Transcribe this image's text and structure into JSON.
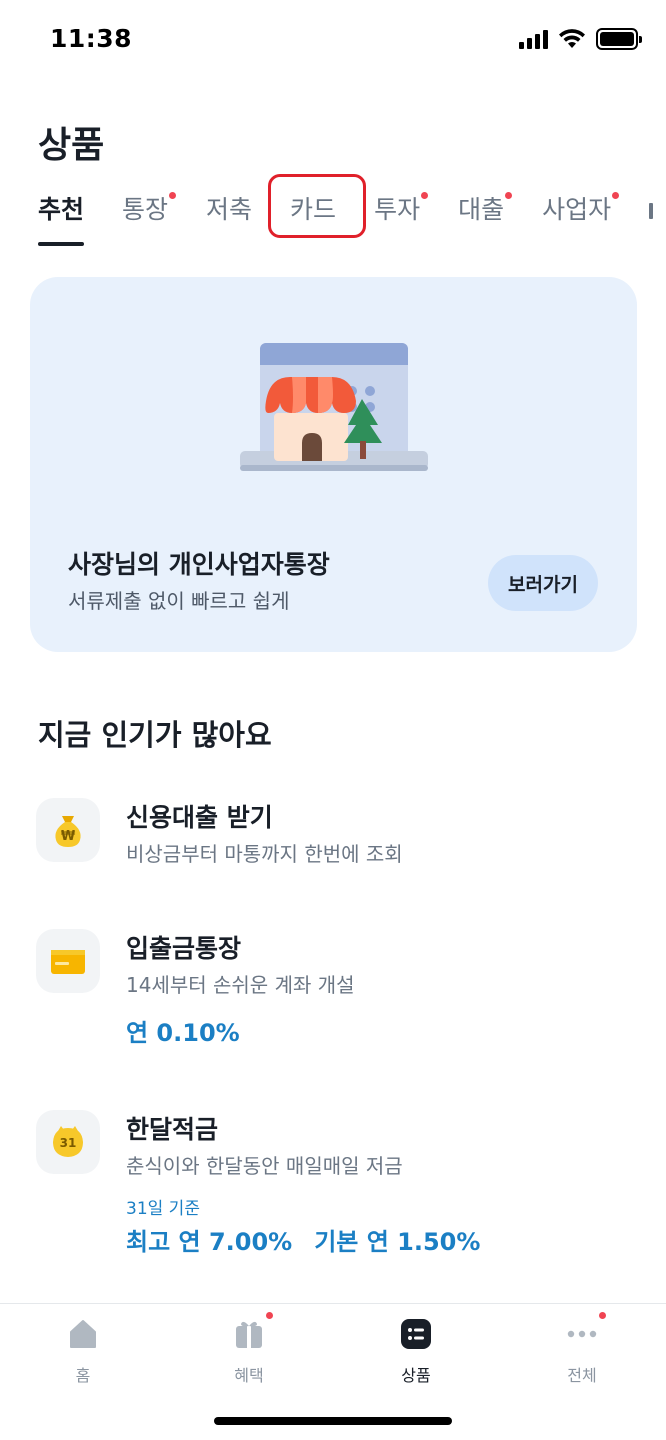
{
  "status_bar": {
    "time": "11:38"
  },
  "page": {
    "title": "상품"
  },
  "tabs": [
    {
      "label": "추천",
      "active": true,
      "dot": false
    },
    {
      "label": "통장",
      "active": false,
      "dot": true
    },
    {
      "label": "저축",
      "active": false,
      "dot": false
    },
    {
      "label": "카드",
      "active": false,
      "dot": false
    },
    {
      "label": "투자",
      "active": false,
      "dot": true
    },
    {
      "label": "대출",
      "active": false,
      "dot": true
    },
    {
      "label": "사업자",
      "active": false,
      "dot": true
    }
  ],
  "banner": {
    "title": "사장님의 개인사업자통장",
    "subtitle": "서류제출 없이 빠르고 쉽게",
    "button_label": "보러가기"
  },
  "popular": {
    "title": "지금 인기가 많아요",
    "items": [
      {
        "icon": "money-bag-icon",
        "title": "신용대출 받기",
        "subtitle": "비상금부터 마통까지 한번에 조회"
      },
      {
        "icon": "bankbook-card-icon",
        "title": "입출금통장",
        "subtitle": "14세부터 손쉬운 계좌 개설",
        "rate": "연 0.10%"
      },
      {
        "icon": "calendar-31-icon",
        "title": "한달적금",
        "subtitle": "춘식이와 한달동안 매일매일 저금",
        "basis": "31일 기준",
        "max_rate": "최고 연 7.00%",
        "base_rate": "기본 연 1.50%"
      }
    ]
  },
  "bottom_nav": [
    {
      "icon": "home-icon",
      "label": "홈",
      "active": false,
      "dot": false
    },
    {
      "icon": "gift-icon",
      "label": "혜택",
      "active": false,
      "dot": true
    },
    {
      "icon": "list-icon",
      "label": "상품",
      "active": true,
      "dot": false
    },
    {
      "icon": "more-icon",
      "label": "전체",
      "active": false,
      "dot": true
    }
  ],
  "colors": {
    "accent_blue": "#1b7fc4",
    "banner_bg": "#e8f1fc",
    "notification_dot": "#f04452",
    "highlight_box": "#e0202a"
  }
}
